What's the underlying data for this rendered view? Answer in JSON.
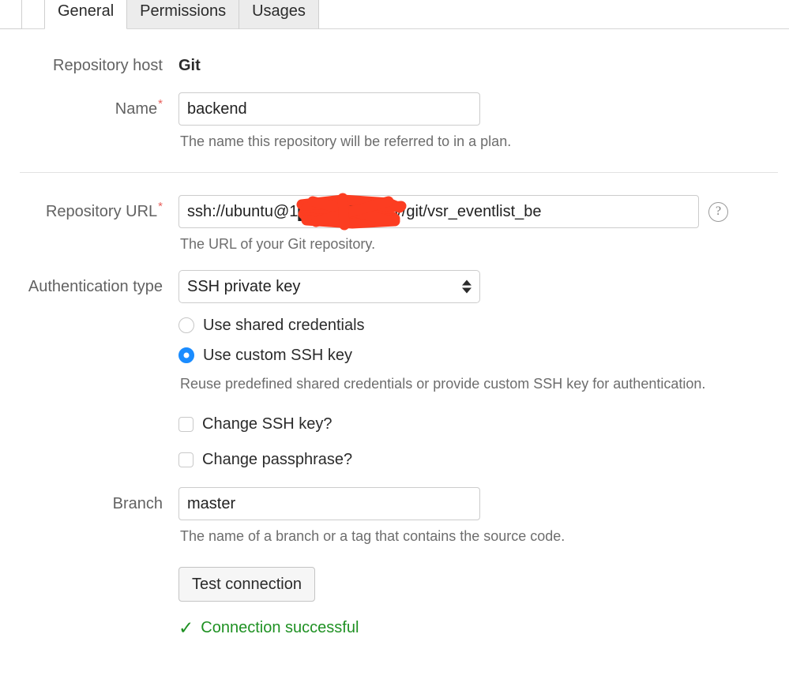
{
  "tabs": [
    {
      "label": "General",
      "active": true
    },
    {
      "label": "Permissions",
      "active": false
    },
    {
      "label": "Usages",
      "active": false
    }
  ],
  "form": {
    "repository_host": {
      "label": "Repository host",
      "value": "Git"
    },
    "name": {
      "label": "Name",
      "required_marker": "*",
      "value": "backend",
      "help": "The name this repository will be referred to in a plan."
    },
    "repository_url": {
      "label": "Repository URL",
      "required_marker": "*",
      "value": "ssh://ubuntu@1███████/srv/git/vsr_eventlist_be",
      "value_prefix": "ssh://ubuntu@1",
      "value_suffix": "/srv/git/vsr_eventlist_be",
      "redacted": true,
      "redaction_color": "#fc3d21",
      "help": "The URL of your Git repository.",
      "help_icon": "question-mark-circle-icon",
      "help_icon_glyph": "?"
    },
    "authentication_type": {
      "label": "Authentication type",
      "selected": "SSH private key",
      "options": [
        "SSH private key"
      ]
    },
    "credential_mode": {
      "options": [
        {
          "label": "Use shared credentials",
          "checked": false
        },
        {
          "label": "Use custom SSH key",
          "checked": true
        }
      ],
      "help": "Reuse predefined shared credentials or provide custom SSH key for authentication.",
      "accent_color": "#1a8cff"
    },
    "change_ssh_key": {
      "label": "Change SSH key?",
      "checked": false
    },
    "change_passphrase": {
      "label": "Change passphrase?",
      "checked": false
    },
    "branch": {
      "label": "Branch",
      "value": "master",
      "help": "The name of a branch or a tag that contains the source code."
    },
    "test_connection": {
      "label": "Test connection"
    },
    "connection_status": {
      "icon": "check-mark-icon",
      "icon_glyph": "✓",
      "text": "Connection successful",
      "color": "#1f9123"
    }
  }
}
